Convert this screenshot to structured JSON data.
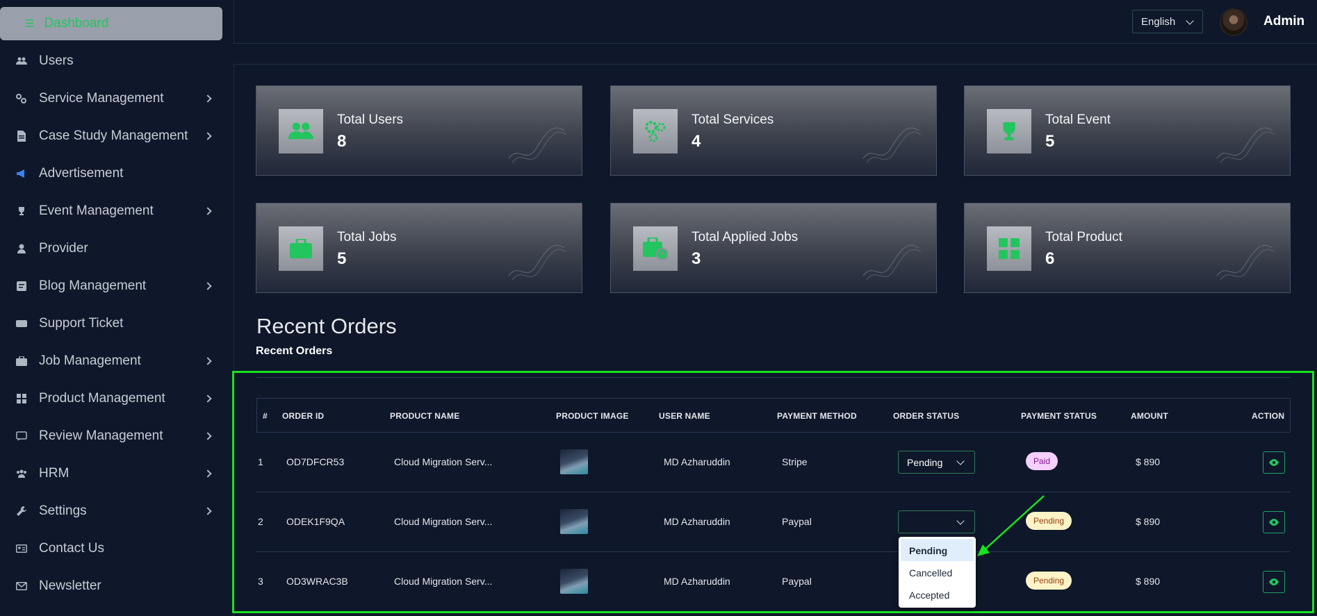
{
  "sidebar": {
    "active": {
      "label": "Dashboard",
      "icon": "dashboard-icon"
    },
    "items": [
      {
        "label": "Users",
        "icon": "users-icon",
        "chevron": false
      },
      {
        "label": "Service Management",
        "icon": "services-icon",
        "chevron": true
      },
      {
        "label": "Case Study Management",
        "icon": "document-icon",
        "chevron": true
      },
      {
        "label": "Advertisement",
        "icon": "megaphone-icon",
        "chevron": false
      },
      {
        "label": "Event Management",
        "icon": "trophy-icon",
        "chevron": true
      },
      {
        "label": "Provider",
        "icon": "user-icon",
        "chevron": false
      },
      {
        "label": "Blog Management",
        "icon": "blog-icon",
        "chevron": true
      },
      {
        "label": "Support Ticket",
        "icon": "ticket-icon",
        "chevron": false
      },
      {
        "label": "Job Management",
        "icon": "briefcase-icon",
        "chevron": true
      },
      {
        "label": "Product Management",
        "icon": "grid-icon",
        "chevron": true
      },
      {
        "label": "Review Management",
        "icon": "review-icon",
        "chevron": true
      },
      {
        "label": "HRM",
        "icon": "team-icon",
        "chevron": true
      },
      {
        "label": "Settings",
        "icon": "wrench-icon",
        "chevron": true
      },
      {
        "label": "Contact Us",
        "icon": "contact-card-icon",
        "chevron": false
      },
      {
        "label": "Newsletter",
        "icon": "mail-icon",
        "chevron": false
      }
    ]
  },
  "header": {
    "language": "English",
    "user_name": "Admin"
  },
  "stats": [
    {
      "title": "Total Users",
      "value": "8",
      "icon": "users-icon"
    },
    {
      "title": "Total Services",
      "value": "4",
      "icon": "gears-icon"
    },
    {
      "title": "Total Event",
      "value": "5",
      "icon": "trophy-icon"
    },
    {
      "title": "Total Jobs",
      "value": "5",
      "icon": "briefcase-icon"
    },
    {
      "title": "Total Applied Jobs",
      "value": "3",
      "icon": "briefcase-clock-icon"
    },
    {
      "title": "Total Product",
      "value": "6",
      "icon": "grid-icon"
    }
  ],
  "recent_orders": {
    "heading": "Recent Orders",
    "subheading": "Recent Orders",
    "columns": [
      "#",
      "ORDER ID",
      "PRODUCT NAME",
      "PRODUCT IMAGE",
      "USER NAME",
      "PAYMENT METHOD",
      "ORDER STATUS",
      "PAYMENT STATUS",
      "AMOUNT",
      "ACTION"
    ],
    "rows": [
      {
        "num": "1",
        "order_id": "OD7DFCR53",
        "product": "Cloud Migration Serv...",
        "user": "MD Azharuddin",
        "method": "Stripe",
        "order_status": "Pending",
        "payment_status": "Paid",
        "amount": "$ 890"
      },
      {
        "num": "2",
        "order_id": "ODEK1F9QA",
        "product": "Cloud Migration Serv...",
        "user": "MD Azharuddin",
        "method": "Paypal",
        "order_status": "",
        "payment_status": "Pending",
        "amount": "$ 890"
      },
      {
        "num": "3",
        "order_id": "OD3WRAC3B",
        "product": "Cloud Migration Serv...",
        "user": "MD Azharuddin",
        "method": "Paypal",
        "order_status": "",
        "payment_status": "Pending",
        "amount": "$ 890"
      }
    ],
    "dropdown_options": [
      "Pending",
      "Cancelled",
      "Accepted"
    ],
    "dropdown_highlighted": "Pending"
  },
  "colors": {
    "accent_green": "#22c55e",
    "highlight_box": "#17e31f",
    "background": "#0f172a"
  }
}
